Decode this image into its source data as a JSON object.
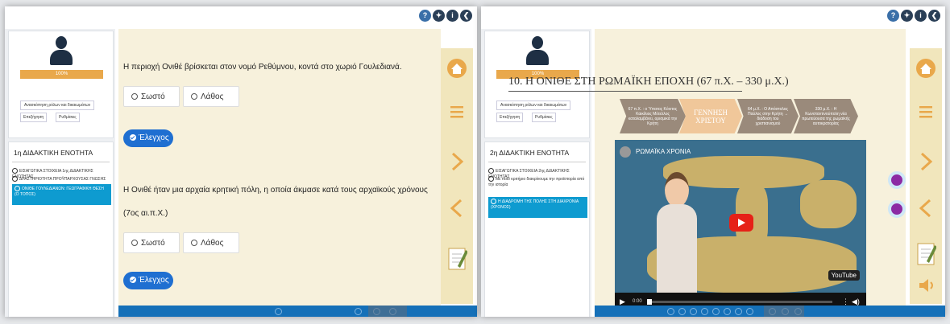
{
  "left_panel": {
    "progress_label": "100%",
    "edit_profile": "Ανασκόπηση ρόλων και δικαιωμάτων",
    "explain_btn": "Επεξήγηση",
    "settings_btn": "Ρυθμίσεις",
    "unit_title": "1η ΔΙΔΑΚΤΙΚΗ ΕΝΟΤΗΤΑ",
    "unit_items": [
      "ΕΙΣΑΓΩΓΙΚΑ ΣΤΟΙΧΕΙΑ 1ης ΔΙΔΑΚΤΙΚΗΣ ΕΝΟΤΗΤΑΣ",
      "ΔΡΑΣΤΗΡΙΟΤΗΤΑ ΠΡΟΫΠΑΡΧΟΥΣΑΣ ΓΝΩΣΗΣ",
      "ΟΝΙΘΕ ΓΟΥΛΕΔΙΑΝΩΝ: ΓΕΩΓΡΑΦΙΚΗ ΘΕΣΗ (Ο ΤΟΠΟΣ)"
    ],
    "q1": "Η περιοχή Ονιθέ βρίσκεται στον νομό Ρεθύμνου, κοντά στο χωριό Γουλεδιανά.",
    "q2": "Η Ονιθέ ήταν μια αρχαία κρητική πόλη, η οποία άκμασε κατά τους αρχαϊκούς χρόνους",
    "q2b": "(7ος αι.π.Χ.)",
    "true_label": "Σωστό",
    "false_label": "Λάθος",
    "check_label": "Έλεγχος"
  },
  "right_panel": {
    "progress_label": "100%",
    "edit_profile": "Ανασκόπηση ρόλων και δικαιωμάτων",
    "explain_btn": "Επεξήγηση",
    "settings_btn": "Ρυθμίσεις",
    "unit_title": "2η ΔΙΔΑΚΤΙΚΗ ΕΝΟΤΗΤΑ",
    "unit_items": [
      "ΕΙΣΑΓΩΓΙΚΑ ΣΤΟΙΧΕΙΑ 2ης ΔΙΔΑΚΤΙΚΗΣ ΕΝΟΤΗΤΑΣ",
      "Με ποιο κριτήριο διακρίνουμε την προϊστορία από την ιστορία",
      "Η ΔΙΑΔΡΟΜΗ ΤΗΣ ΠΟΛΗΣ ΣΤΗ ΔΙΑΧΡΟΝΙΑ (ΧΡΟΝΟΣ)"
    ],
    "slide_title": "10. Η ΟΝΙΘΕ ΣΤΗ ΡΩΜΑΪΚΗ ΕΠΟΧΗ (67 π.Χ. – 330 μ.Χ.)",
    "timeline": [
      "67 π.Χ. : ο Ύπατος Κόιντος Καικίλιος Μέτελλος καταλαμβάνει, ορισμικά την Κρήτη",
      "ΓΕΝΝΗΣΗ ΧΡΙΣΤΟΥ",
      "64 μ.Χ. : Ο Απόστολος Παύλος στην Κρήτη → διάδοση του χριστιανισμού",
      "330 μ.Χ. : Η Κωνσταντινούπολη νέα πρωτεύουσα της ρωμαϊκής αυτοκρατορίας"
    ],
    "video_title": "ΡΩΜΑΪΚΑ ΧΡΟΝΙΑ",
    "video_time": "0:00",
    "video_brand": "YouTube"
  },
  "colors": {
    "accent": "#1f6fd1",
    "nav_blue": "#1570b8",
    "progress": "#e9a84b",
    "rail": "#f1e6bc",
    "active_item": "#0e9bd0"
  }
}
